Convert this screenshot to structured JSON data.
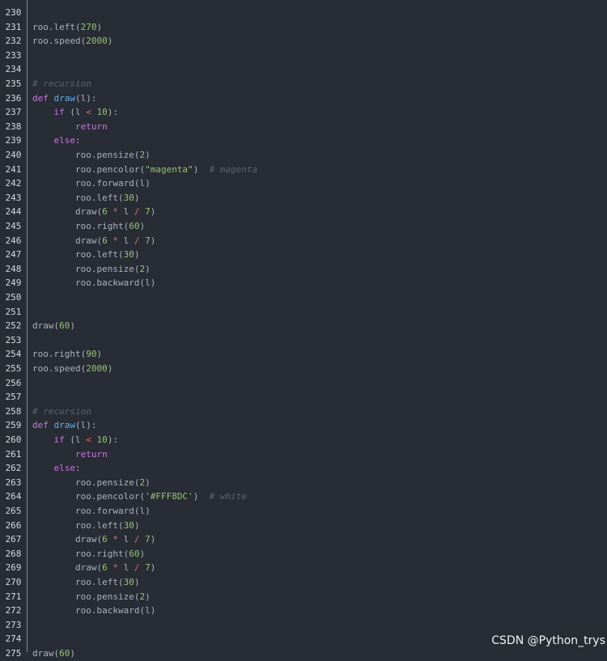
{
  "watermark": "CSDN @Python_trys",
  "lines": [
    {
      "n": "230",
      "tokens": []
    },
    {
      "n": "231",
      "tokens": [
        [
          "plain",
          "roo.left("
        ],
        [
          "num",
          "270"
        ],
        [
          "plain",
          ")"
        ]
      ]
    },
    {
      "n": "232",
      "tokens": [
        [
          "plain",
          "roo.speed("
        ],
        [
          "num",
          "2000"
        ],
        [
          "plain",
          ")"
        ]
      ]
    },
    {
      "n": "233",
      "tokens": []
    },
    {
      "n": "234",
      "tokens": []
    },
    {
      "n": "235",
      "tokens": [
        [
          "cmt",
          "# recursion"
        ]
      ]
    },
    {
      "n": "236",
      "tokens": [
        [
          "kw",
          "def "
        ],
        [
          "fn",
          "draw"
        ],
        [
          "plain",
          "(l):"
        ]
      ]
    },
    {
      "n": "237",
      "tokens": [
        [
          "plain",
          "    "
        ],
        [
          "kw",
          "if"
        ],
        [
          "plain",
          " (l "
        ],
        [
          "op",
          "<"
        ],
        [
          "plain",
          " "
        ],
        [
          "num",
          "10"
        ],
        [
          "plain",
          "):"
        ]
      ]
    },
    {
      "n": "238",
      "tokens": [
        [
          "plain",
          "        "
        ],
        [
          "kw",
          "return"
        ]
      ]
    },
    {
      "n": "239",
      "tokens": [
        [
          "plain",
          "    "
        ],
        [
          "kw",
          "else"
        ],
        [
          "plain",
          ":"
        ]
      ]
    },
    {
      "n": "240",
      "tokens": [
        [
          "plain",
          "        roo.pensize("
        ],
        [
          "num",
          "2"
        ],
        [
          "plain",
          ")"
        ]
      ]
    },
    {
      "n": "241",
      "tokens": [
        [
          "plain",
          "        roo.pencolor("
        ],
        [
          "str",
          "\"magenta\""
        ],
        [
          "plain",
          ")  "
        ],
        [
          "cmt",
          "# magenta"
        ]
      ]
    },
    {
      "n": "242",
      "tokens": [
        [
          "plain",
          "        roo.forward(l)"
        ]
      ]
    },
    {
      "n": "243",
      "tokens": [
        [
          "plain",
          "        roo.left("
        ],
        [
          "num",
          "30"
        ],
        [
          "plain",
          ")"
        ]
      ]
    },
    {
      "n": "244",
      "tokens": [
        [
          "plain",
          "        draw("
        ],
        [
          "num",
          "6"
        ],
        [
          "plain",
          " "
        ],
        [
          "op",
          "*"
        ],
        [
          "plain",
          " l "
        ],
        [
          "op",
          "/"
        ],
        [
          "plain",
          " "
        ],
        [
          "num",
          "7"
        ],
        [
          "plain",
          ")"
        ]
      ]
    },
    {
      "n": "245",
      "tokens": [
        [
          "plain",
          "        roo.right("
        ],
        [
          "num",
          "60"
        ],
        [
          "plain",
          ")"
        ]
      ]
    },
    {
      "n": "246",
      "tokens": [
        [
          "plain",
          "        draw("
        ],
        [
          "num",
          "6"
        ],
        [
          "plain",
          " "
        ],
        [
          "op",
          "*"
        ],
        [
          "plain",
          " l "
        ],
        [
          "op",
          "/"
        ],
        [
          "plain",
          " "
        ],
        [
          "num",
          "7"
        ],
        [
          "plain",
          ")"
        ]
      ]
    },
    {
      "n": "247",
      "tokens": [
        [
          "plain",
          "        roo.left("
        ],
        [
          "num",
          "30"
        ],
        [
          "plain",
          ")"
        ]
      ]
    },
    {
      "n": "248",
      "tokens": [
        [
          "plain",
          "        roo.pensize("
        ],
        [
          "num",
          "2"
        ],
        [
          "plain",
          ")"
        ]
      ]
    },
    {
      "n": "249",
      "tokens": [
        [
          "plain",
          "        roo.backward(l)"
        ]
      ]
    },
    {
      "n": "250",
      "tokens": []
    },
    {
      "n": "251",
      "tokens": []
    },
    {
      "n": "252",
      "tokens": [
        [
          "plain",
          "draw("
        ],
        [
          "num",
          "60"
        ],
        [
          "plain",
          ")"
        ]
      ]
    },
    {
      "n": "253",
      "tokens": []
    },
    {
      "n": "254",
      "tokens": [
        [
          "plain",
          "roo.right("
        ],
        [
          "num",
          "90"
        ],
        [
          "plain",
          ")"
        ]
      ]
    },
    {
      "n": "255",
      "tokens": [
        [
          "plain",
          "roo.speed("
        ],
        [
          "num",
          "2000"
        ],
        [
          "plain",
          ")"
        ]
      ]
    },
    {
      "n": "256",
      "tokens": []
    },
    {
      "n": "257",
      "tokens": []
    },
    {
      "n": "258",
      "tokens": [
        [
          "cmt",
          "# recursion"
        ]
      ]
    },
    {
      "n": "259",
      "tokens": [
        [
          "kw",
          "def "
        ],
        [
          "fn",
          "draw"
        ],
        [
          "plain",
          "(l):"
        ]
      ]
    },
    {
      "n": "260",
      "tokens": [
        [
          "plain",
          "    "
        ],
        [
          "kw",
          "if"
        ],
        [
          "plain",
          " (l "
        ],
        [
          "op",
          "<"
        ],
        [
          "plain",
          " "
        ],
        [
          "num",
          "10"
        ],
        [
          "plain",
          "):"
        ]
      ]
    },
    {
      "n": "261",
      "tokens": [
        [
          "plain",
          "        "
        ],
        [
          "kw",
          "return"
        ]
      ]
    },
    {
      "n": "262",
      "tokens": [
        [
          "plain",
          "    "
        ],
        [
          "kw",
          "else"
        ],
        [
          "plain",
          ":"
        ]
      ]
    },
    {
      "n": "263",
      "tokens": [
        [
          "plain",
          "        roo.pensize("
        ],
        [
          "num",
          "2"
        ],
        [
          "plain",
          ")"
        ]
      ]
    },
    {
      "n": "264",
      "tokens": [
        [
          "plain",
          "        roo.pencolor("
        ],
        [
          "str",
          "'#FFF8DC'"
        ],
        [
          "plain",
          ")  "
        ],
        [
          "cmt",
          "# white"
        ]
      ]
    },
    {
      "n": "265",
      "tokens": [
        [
          "plain",
          "        roo.forward(l)"
        ]
      ]
    },
    {
      "n": "266",
      "tokens": [
        [
          "plain",
          "        roo.left("
        ],
        [
          "num",
          "30"
        ],
        [
          "plain",
          ")"
        ]
      ]
    },
    {
      "n": "267",
      "tokens": [
        [
          "plain",
          "        draw("
        ],
        [
          "num",
          "6"
        ],
        [
          "plain",
          " "
        ],
        [
          "op",
          "*"
        ],
        [
          "plain",
          " l "
        ],
        [
          "op",
          "/"
        ],
        [
          "plain",
          " "
        ],
        [
          "num",
          "7"
        ],
        [
          "plain",
          ")"
        ]
      ]
    },
    {
      "n": "268",
      "tokens": [
        [
          "plain",
          "        roo.right("
        ],
        [
          "num",
          "60"
        ],
        [
          "plain",
          ")"
        ]
      ]
    },
    {
      "n": "269",
      "tokens": [
        [
          "plain",
          "        draw("
        ],
        [
          "num",
          "6"
        ],
        [
          "plain",
          " "
        ],
        [
          "op",
          "*"
        ],
        [
          "plain",
          " l "
        ],
        [
          "op",
          "/"
        ],
        [
          "plain",
          " "
        ],
        [
          "num",
          "7"
        ],
        [
          "plain",
          ")"
        ]
      ]
    },
    {
      "n": "270",
      "tokens": [
        [
          "plain",
          "        roo.left("
        ],
        [
          "num",
          "30"
        ],
        [
          "plain",
          ")"
        ]
      ]
    },
    {
      "n": "271",
      "tokens": [
        [
          "plain",
          "        roo.pensize("
        ],
        [
          "num",
          "2"
        ],
        [
          "plain",
          ")"
        ]
      ]
    },
    {
      "n": "272",
      "tokens": [
        [
          "plain",
          "        roo.backward(l)"
        ]
      ]
    },
    {
      "n": "273",
      "tokens": []
    },
    {
      "n": "274",
      "tokens": []
    },
    {
      "n": "275",
      "tokens": [
        [
          "plain",
          "draw("
        ],
        [
          "num",
          "60"
        ],
        [
          "plain",
          ")"
        ]
      ]
    }
  ]
}
